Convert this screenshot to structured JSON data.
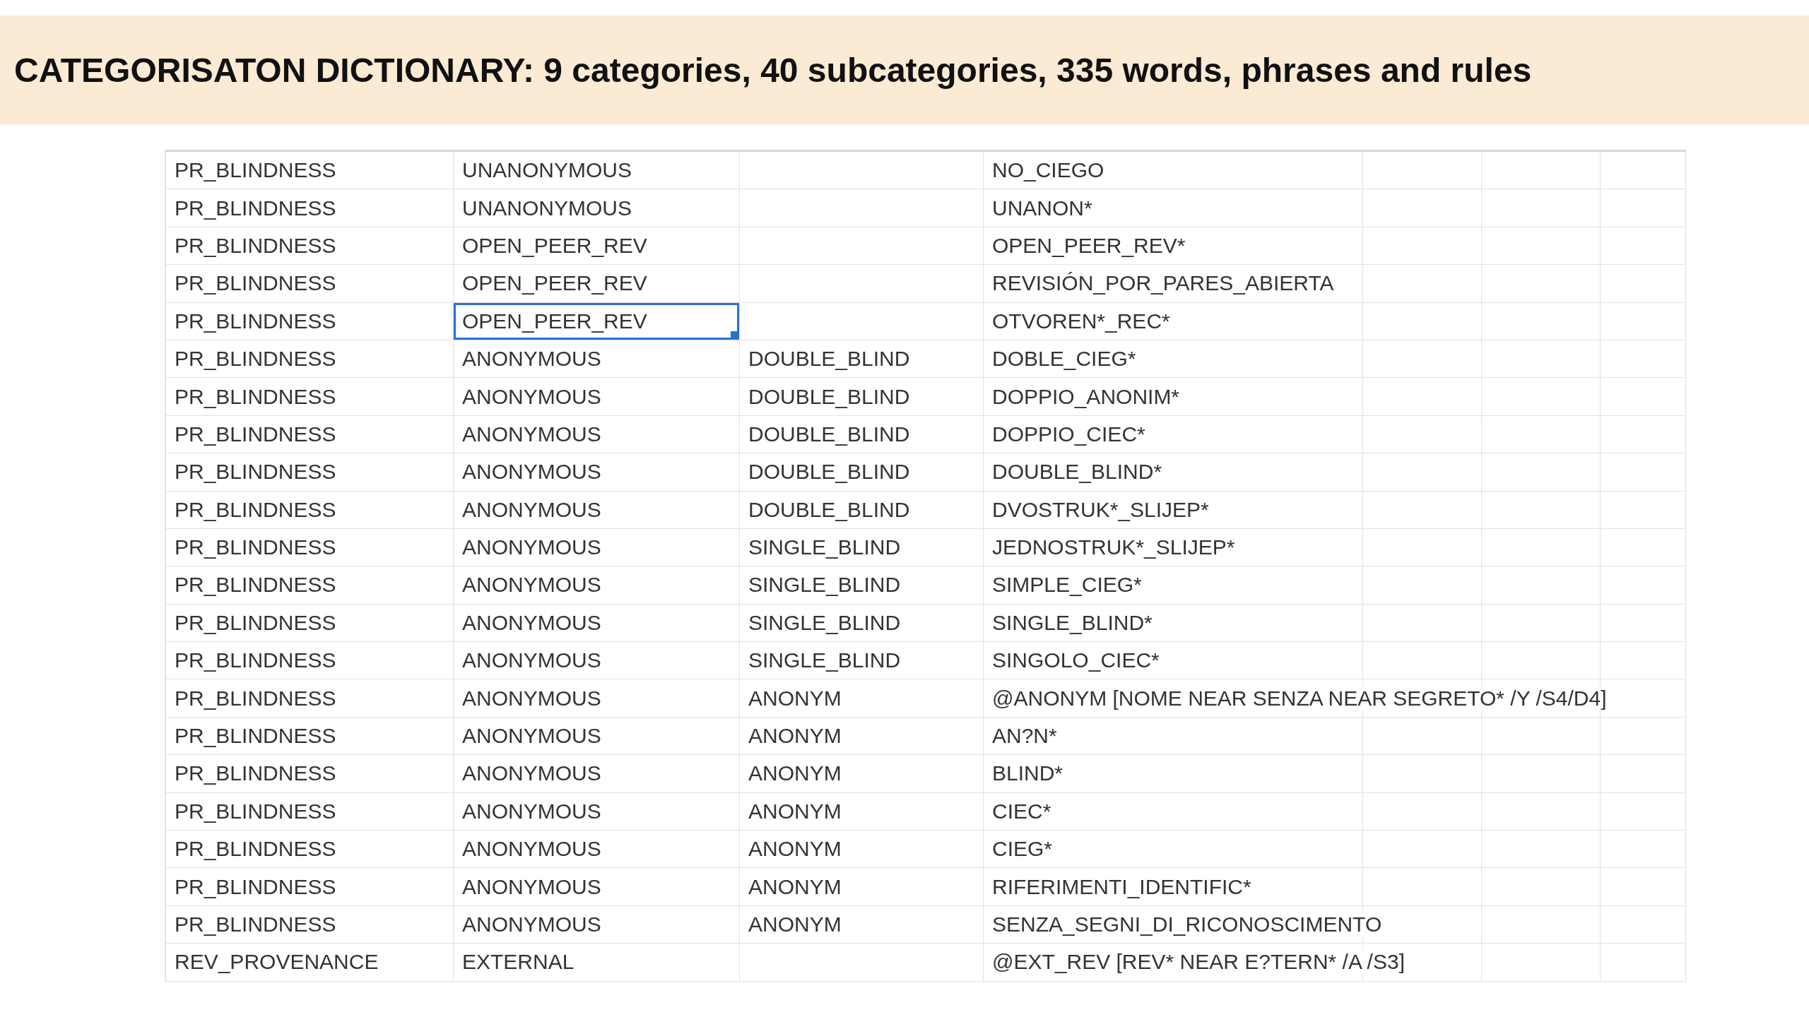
{
  "title": "CATEGORISATON DICTIONARY: 9 categories, 40 subcategories, 335 words, phrases and rules",
  "table": {
    "rows": [
      {
        "cells": [
          {
            "text": "PR_BLINDNESS",
            "selected": false
          },
          {
            "text": "UNANONYMOUS",
            "selected": false
          },
          {
            "selected": false
          },
          {
            "text": "NO_CIEGO",
            "selected": false
          }
        ]
      },
      {
        "cells": [
          {
            "text": "PR_BLINDNESS",
            "selected": false
          },
          {
            "text": "UNANONYMOUS",
            "selected": false
          },
          {
            "selected": false
          },
          {
            "text": "UNANON*",
            "selected": false
          }
        ]
      },
      {
        "cells": [
          {
            "text": "PR_BLINDNESS",
            "selected": false
          },
          {
            "text": "OPEN_PEER_REV",
            "selected": false
          },
          {
            "selected": false
          },
          {
            "text": "OPEN_PEER_REV*",
            "selected": false
          }
        ]
      },
      {
        "cells": [
          {
            "text": "PR_BLINDNESS",
            "selected": false
          },
          {
            "text": "OPEN_PEER_REV",
            "selected": false
          },
          {
            "selected": false
          },
          {
            "text": "REVISIÓN_POR_PARES_ABIERTA",
            "selected": false
          }
        ]
      },
      {
        "cells": [
          {
            "text": "PR_BLINDNESS",
            "selected": false
          },
          {
            "text": "OPEN_PEER_REV",
            "selected": true
          },
          {
            "selected": false
          },
          {
            "text": "OTVOREN*_REC*",
            "selected": false
          }
        ]
      },
      {
        "cells": [
          {
            "text": "PR_BLINDNESS",
            "selected": false
          },
          {
            "text": "ANONYMOUS",
            "selected": false
          },
          {
            "text": "DOUBLE_BLIND",
            "selected": false
          },
          {
            "text": "DOBLE_CIEG*",
            "selected": false
          }
        ]
      },
      {
        "cells": [
          {
            "text": "PR_BLINDNESS",
            "selected": false
          },
          {
            "text": "ANONYMOUS",
            "selected": false
          },
          {
            "text": "DOUBLE_BLIND",
            "selected": false
          },
          {
            "text": "DOPPIO_ANONIM*",
            "selected": false
          }
        ]
      },
      {
        "cells": [
          {
            "text": "PR_BLINDNESS",
            "selected": false
          },
          {
            "text": "ANONYMOUS",
            "selected": false
          },
          {
            "text": "DOUBLE_BLIND",
            "selected": false
          },
          {
            "text": "DOPPIO_CIEC*",
            "selected": false
          }
        ]
      },
      {
        "cells": [
          {
            "text": "PR_BLINDNESS",
            "selected": false
          },
          {
            "text": "ANONYMOUS",
            "selected": false
          },
          {
            "text": "DOUBLE_BLIND",
            "selected": false
          },
          {
            "text": "DOUBLE_BLIND*",
            "selected": false
          }
        ]
      },
      {
        "cells": [
          {
            "text": "PR_BLINDNESS",
            "selected": false
          },
          {
            "text": "ANONYMOUS",
            "selected": false
          },
          {
            "text": "DOUBLE_BLIND",
            "selected": false
          },
          {
            "text": "DVOSTRUK*_SLIJEP*",
            "selected": false
          }
        ]
      },
      {
        "cells": [
          {
            "text": "PR_BLINDNESS",
            "selected": false
          },
          {
            "text": "ANONYMOUS",
            "selected": false
          },
          {
            "text": "SINGLE_BLIND",
            "selected": false
          },
          {
            "text": "JEDNOSTRUK*_SLIJEP*",
            "selected": false
          }
        ]
      },
      {
        "cells": [
          {
            "text": "PR_BLINDNESS",
            "selected": false
          },
          {
            "text": "ANONYMOUS",
            "selected": false
          },
          {
            "text": "SINGLE_BLIND",
            "selected": false
          },
          {
            "text": "SIMPLE_CIEG*",
            "selected": false
          }
        ]
      },
      {
        "cells": [
          {
            "text": "PR_BLINDNESS",
            "selected": false
          },
          {
            "text": "ANONYMOUS",
            "selected": false
          },
          {
            "text": "SINGLE_BLIND",
            "selected": false
          },
          {
            "text": "SINGLE_BLIND*",
            "selected": false
          }
        ]
      },
      {
        "cells": [
          {
            "text": "PR_BLINDNESS",
            "selected": false
          },
          {
            "text": "ANONYMOUS",
            "selected": false
          },
          {
            "text": "SINGLE_BLIND",
            "selected": false
          },
          {
            "text": "SINGOLO_CIEC*",
            "selected": false
          }
        ]
      },
      {
        "cells": [
          {
            "text": "PR_BLINDNESS",
            "selected": false
          },
          {
            "text": "ANONYMOUS",
            "selected": false
          },
          {
            "text": "ANONYM",
            "selected": false
          },
          {
            "text": "@ANONYM [NOME NEAR SENZA NEAR SEGRETO* /Y /S4/D4]",
            "selected": false
          }
        ]
      },
      {
        "cells": [
          {
            "text": "PR_BLINDNESS",
            "selected": false
          },
          {
            "text": "ANONYMOUS",
            "selected": false
          },
          {
            "text": "ANONYM",
            "selected": false
          },
          {
            "text": "AN?N*",
            "selected": false
          }
        ]
      },
      {
        "cells": [
          {
            "text": "PR_BLINDNESS",
            "selected": false
          },
          {
            "text": "ANONYMOUS",
            "selected": false
          },
          {
            "text": "ANONYM",
            "selected": false
          },
          {
            "text": "BLIND*",
            "selected": false
          }
        ]
      },
      {
        "cells": [
          {
            "text": "PR_BLINDNESS",
            "selected": false
          },
          {
            "text": "ANONYMOUS",
            "selected": false
          },
          {
            "text": "ANONYM",
            "selected": false
          },
          {
            "text": "CIEC*",
            "selected": false
          }
        ]
      },
      {
        "cells": [
          {
            "text": "PR_BLINDNESS",
            "selected": false
          },
          {
            "text": "ANONYMOUS",
            "selected": false
          },
          {
            "text": "ANONYM",
            "selected": false
          },
          {
            "text": "CIEG*",
            "selected": false
          }
        ]
      },
      {
        "cells": [
          {
            "text": "PR_BLINDNESS",
            "selected": false
          },
          {
            "text": "ANONYMOUS",
            "selected": false
          },
          {
            "text": "ANONYM",
            "selected": false
          },
          {
            "text": "RIFERIMENTI_IDENTIFIC*",
            "selected": false
          }
        ]
      },
      {
        "cells": [
          {
            "text": "PR_BLINDNESS",
            "selected": false
          },
          {
            "text": "ANONYMOUS",
            "selected": false
          },
          {
            "text": "ANONYM",
            "selected": false
          },
          {
            "text": "SENZA_SEGNI_DI_RICONOSCIMENTO",
            "selected": false
          }
        ]
      },
      {
        "cells": [
          {
            "text": "REV_PROVENANCE",
            "selected": false
          },
          {
            "text": "EXTERNAL",
            "selected": false
          },
          {
            "selected": false
          },
          {
            "text": "@EXT_REV [REV* NEAR E?TERN* /A /S3]",
            "selected": false
          }
        ]
      }
    ]
  }
}
